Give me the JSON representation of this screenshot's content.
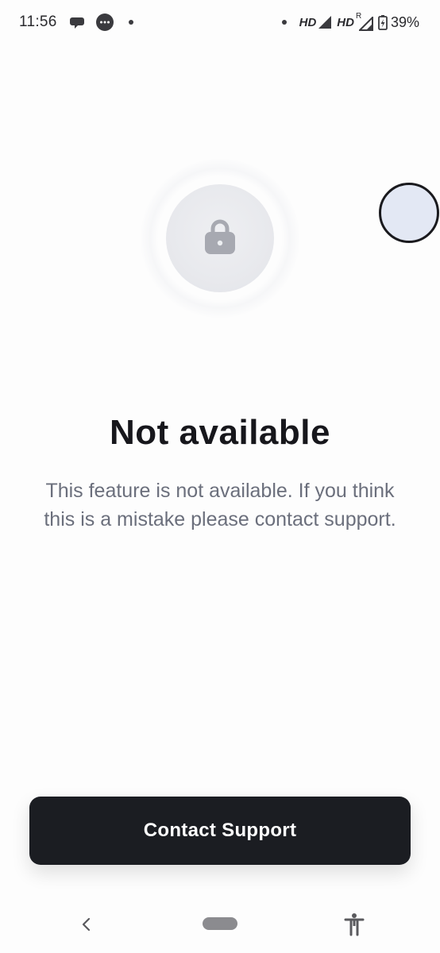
{
  "status_bar": {
    "time": "11:56",
    "network_1": "HD",
    "network_2": "HD",
    "roaming": "R",
    "battery_percent": "39%",
    "icons": [
      "chat-bubble-icon",
      "messages-icon",
      "notification-dot-icon",
      "dot-icon",
      "signal-icon",
      "signal-roaming-icon",
      "battery-charging-icon"
    ]
  },
  "main": {
    "icon": "lock-icon",
    "title": "Not available",
    "message": "This feature is not available. If you think this is a mistake please contact support.",
    "button_label": "Contact Support"
  },
  "nav_bar": {
    "icons": [
      "back-icon",
      "home-pill-icon",
      "accessibility-icon"
    ]
  },
  "colors": {
    "background": "#fdfdfd",
    "title": "#17171c",
    "message": "#6b6f7c",
    "button_bg": "#1b1d22",
    "button_text": "#ffffff",
    "lock_icon": "#a7a9b1",
    "lock_circle": "#e8e9ed",
    "floating_bubble": "#e3e8f4"
  }
}
